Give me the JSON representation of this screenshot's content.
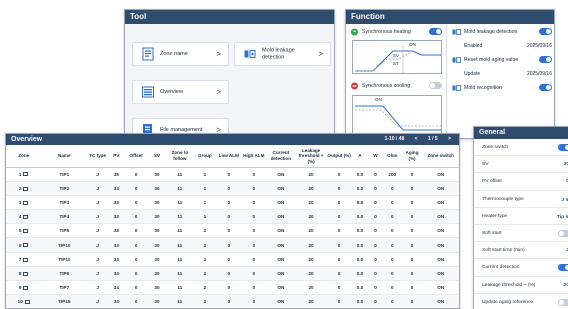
{
  "tool": {
    "title": "Tool",
    "zone_name": "Zone name",
    "mold_leakage_detection": "Mold leakage detection",
    "overview": "Overview",
    "file_management": "File management",
    "chevron": ">"
  },
  "function": {
    "title": "Function",
    "synchronous_heating": "Synchronous heating",
    "synchronous_heating_state": "on",
    "synchronous_cooling": "Synchronous cooling",
    "synchronous_cooling_state": "off",
    "chart1_on": "ON",
    "chart1_sv": "SV",
    "chart1_st": "ST",
    "chart2_on": "ON",
    "mold_leakage_detection": "Mold leakage detection",
    "mold_leakage_state": "on",
    "enabled_label": "Enabled",
    "enabled_date": "2025/09/16",
    "reset_mold_aging": "Reset mold aging value",
    "reset_state": "on",
    "update_label": "Update",
    "update_date": "2025/09/16",
    "mold_recognition": "Mold recognition",
    "mold_recognition_state": "on"
  },
  "overview": {
    "title": "Overview",
    "pager_range": "1-10 / 48",
    "pager_prev": "<",
    "pager_page": "1 / 5",
    "pager_next": ">",
    "columns": [
      "Zone",
      "Name",
      "TC type",
      "PV",
      "Offset",
      "SV",
      "Zone to follow",
      "Group",
      "Low ALM",
      "High ALM",
      "Current detection",
      "Leakage threshold +(%)",
      "Output (%)",
      "A",
      "W",
      "Ohm",
      "Aging (%)",
      "Zone switch"
    ],
    "rows": [
      [
        "1",
        "TIP1",
        "J",
        "35",
        "0",
        "30",
        "11",
        "1",
        "0",
        "0",
        "ON",
        "20",
        "0",
        "0.0",
        "0",
        "200",
        "0",
        "ON"
      ],
      [
        "2",
        "TIP2",
        "J",
        "33",
        "0",
        "30",
        "11",
        "1",
        "0",
        "0",
        "ON",
        "20",
        "0",
        "0.0",
        "0",
        "0",
        "0",
        "ON"
      ],
      [
        "3",
        "TIP3",
        "J",
        "33",
        "0",
        "30",
        "11",
        "1",
        "0",
        "0",
        "ON",
        "20",
        "0",
        "0.0",
        "0",
        "0",
        "0",
        "ON"
      ],
      [
        "4",
        "TIP4",
        "J",
        "33",
        "0",
        "30",
        "11",
        "1",
        "0",
        "0",
        "ON",
        "20",
        "0",
        "0.0",
        "0",
        "0",
        "0",
        "ON"
      ],
      [
        "5",
        "TIP5",
        "J",
        "33",
        "0",
        "30",
        "11",
        "2",
        "0",
        "0",
        "ON",
        "20",
        "0",
        "0.0",
        "0",
        "0",
        "0",
        "ON"
      ],
      [
        "6",
        "TIP10",
        "J",
        "33",
        "0",
        "30",
        "11",
        "2",
        "0",
        "0",
        "ON",
        "20",
        "0",
        "0.0",
        "0",
        "0",
        "0",
        "ON"
      ],
      [
        "7",
        "TIP11",
        "J",
        "33",
        "0",
        "30",
        "11",
        "2",
        "0",
        "0",
        "ON",
        "20",
        "0",
        "0.0",
        "0",
        "0",
        "0",
        "ON"
      ],
      [
        "8",
        "TIP6",
        "J",
        "34",
        "0",
        "30",
        "11",
        "2",
        "0",
        "0",
        "ON",
        "20",
        "0",
        "0.0",
        "0",
        "0",
        "0",
        "ON"
      ],
      [
        "9",
        "TIP7",
        "J",
        "34",
        "0",
        "30",
        "11",
        "2",
        "0",
        "0",
        "ON",
        "20",
        "0",
        "0.0",
        "0",
        "0",
        "0",
        "ON"
      ],
      [
        "10",
        "TIP15",
        "J",
        "34",
        "0",
        "30",
        "11",
        "2",
        "0",
        "0",
        "ON",
        "20",
        "0",
        "0.0",
        "0",
        "0",
        "0",
        "ON"
      ]
    ]
  },
  "general": {
    "title": "General",
    "rows": [
      {
        "label": "Zone switch",
        "type": "toggle",
        "state": "on",
        "value": ""
      },
      {
        "label": "SV",
        "type": "value",
        "state": "",
        "value": "30"
      },
      {
        "label": "PV offset",
        "type": "value",
        "state": "",
        "value": "0"
      },
      {
        "label": "Thermocouple type",
        "type": "value",
        "state": "",
        "value": "J ∨"
      },
      {
        "label": "Heater type",
        "type": "value",
        "state": "",
        "value": "Tip ∨"
      },
      {
        "label": "Soft start",
        "type": "toggle",
        "state": "off",
        "value": ""
      },
      {
        "label": "Soft start time (min)",
        "type": "value",
        "state": "",
        "value": "3"
      },
      {
        "label": "Current detection",
        "type": "toggle",
        "state": "on",
        "value": ""
      },
      {
        "label": "Leakage threshold + (%)",
        "type": "value",
        "state": "",
        "value": "20"
      },
      {
        "label": "Update aging reference",
        "type": "toggle",
        "state": "off",
        "value": ""
      }
    ]
  },
  "colors": {
    "header": "#2f4b6e",
    "toggle_on": "#2f6fd6",
    "toggle_off": "#c9ced6"
  }
}
